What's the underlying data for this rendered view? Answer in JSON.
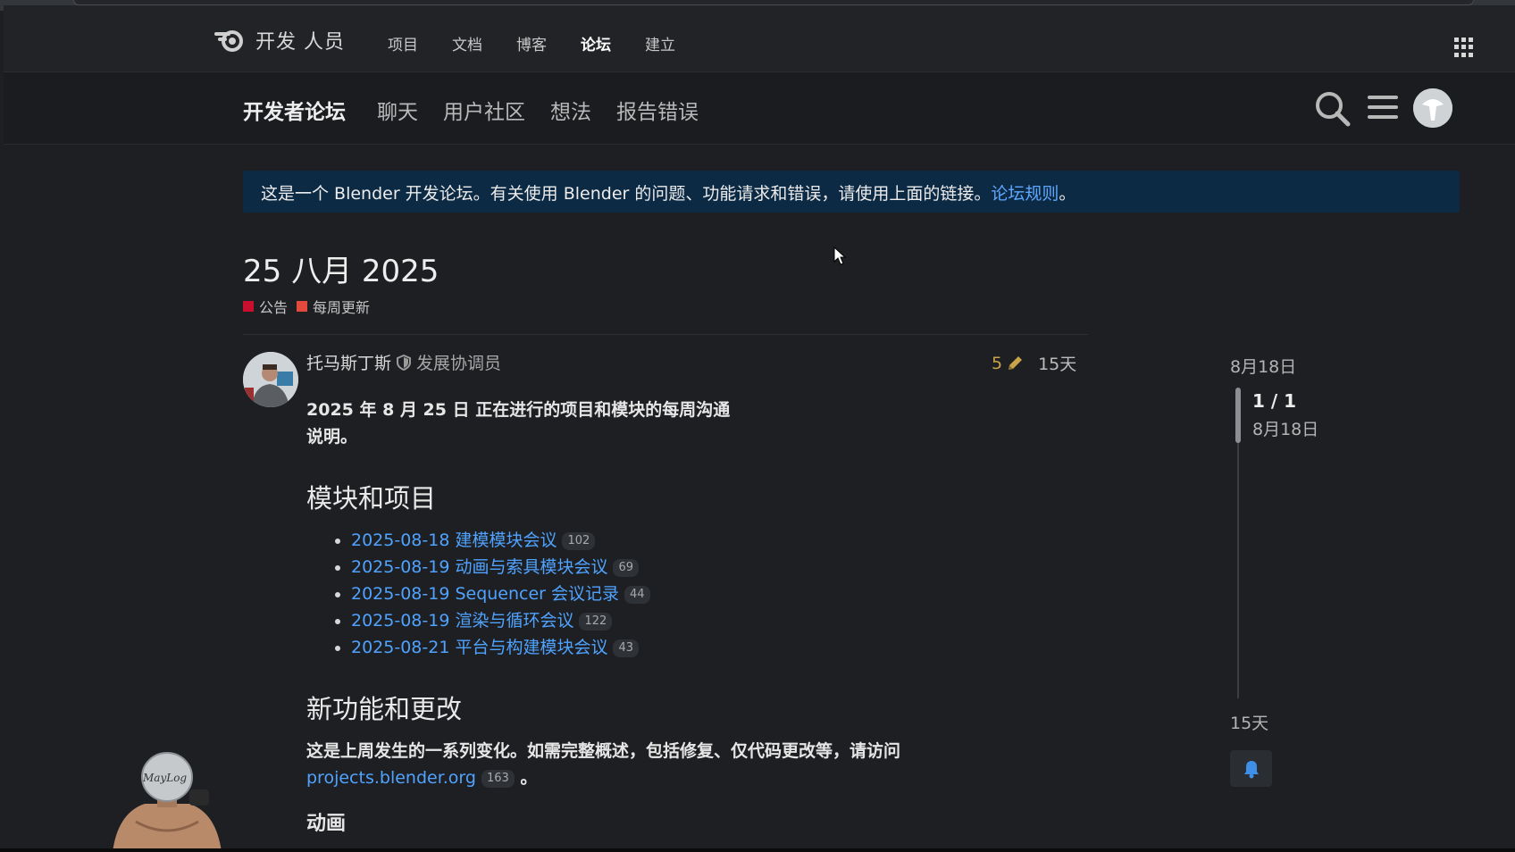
{
  "site": {
    "name": "开发 人员",
    "nav": [
      {
        "label": "项目",
        "active": false
      },
      {
        "label": "文档",
        "active": false
      },
      {
        "label": "博客",
        "active": false
      },
      {
        "label": "论坛",
        "active": true
      },
      {
        "label": "建立",
        "active": false
      }
    ]
  },
  "forum": {
    "title": "开发者论坛",
    "links": [
      "聊天",
      "用户社区",
      "想法",
      "报告错误"
    ]
  },
  "banner": {
    "text": "这是一个 Blender 开发论坛。有关使用 Blender 的问题、功能请求和错误，请使用上面的链接。",
    "link": "论坛规则",
    "suffix": "。"
  },
  "topic": {
    "title": "25 八月 2025",
    "tags": [
      {
        "label": "公告",
        "color": "#c8102e"
      },
      {
        "label": "每周更新",
        "color": "#e14a3c"
      }
    ]
  },
  "post": {
    "author": "托马斯丁斯",
    "role": "发展协调员",
    "edits": "5",
    "age": "15天",
    "intro": "2025 年 8 月 25 日 正在进行的项目和模块的每周沟通说明。",
    "section1_title": "模块和项目",
    "links": [
      {
        "text": "2025-08-18 建模模块会议",
        "count": "102"
      },
      {
        "text": "2025-08-19 动画与索具模块会议",
        "count": "69"
      },
      {
        "text": "2025-08-19 Sequencer 会议记录",
        "count": "44"
      },
      {
        "text": "2025-08-19 渲染与循环会议",
        "count": "122"
      },
      {
        "text": "2025-08-21 平台与构建模块会议",
        "count": "43"
      }
    ],
    "section2_title": "新功能和更改",
    "changes_text": "这是上周发生的一系列变化。如需完整概述，包括修复、仅代码更改等，请访问",
    "changes_link": "projects.blender.org",
    "changes_count": "163",
    "changes_suffix": "。",
    "section3_title": "动画"
  },
  "timeline": {
    "start": "8月18日",
    "position": "1 / 1",
    "position_date": "8月18日",
    "end": "15天"
  },
  "webcam": {
    "badge": "MayLog"
  },
  "icons": {
    "logo": "blender-logo-icon",
    "apps": "apps-grid-icon",
    "search": "search-icon",
    "menu": "hamburger-menu-icon",
    "shield": "shield-icon",
    "pencil": "pencil-icon",
    "bell": "bell-icon",
    "cursor": "mouse-cursor-icon"
  }
}
